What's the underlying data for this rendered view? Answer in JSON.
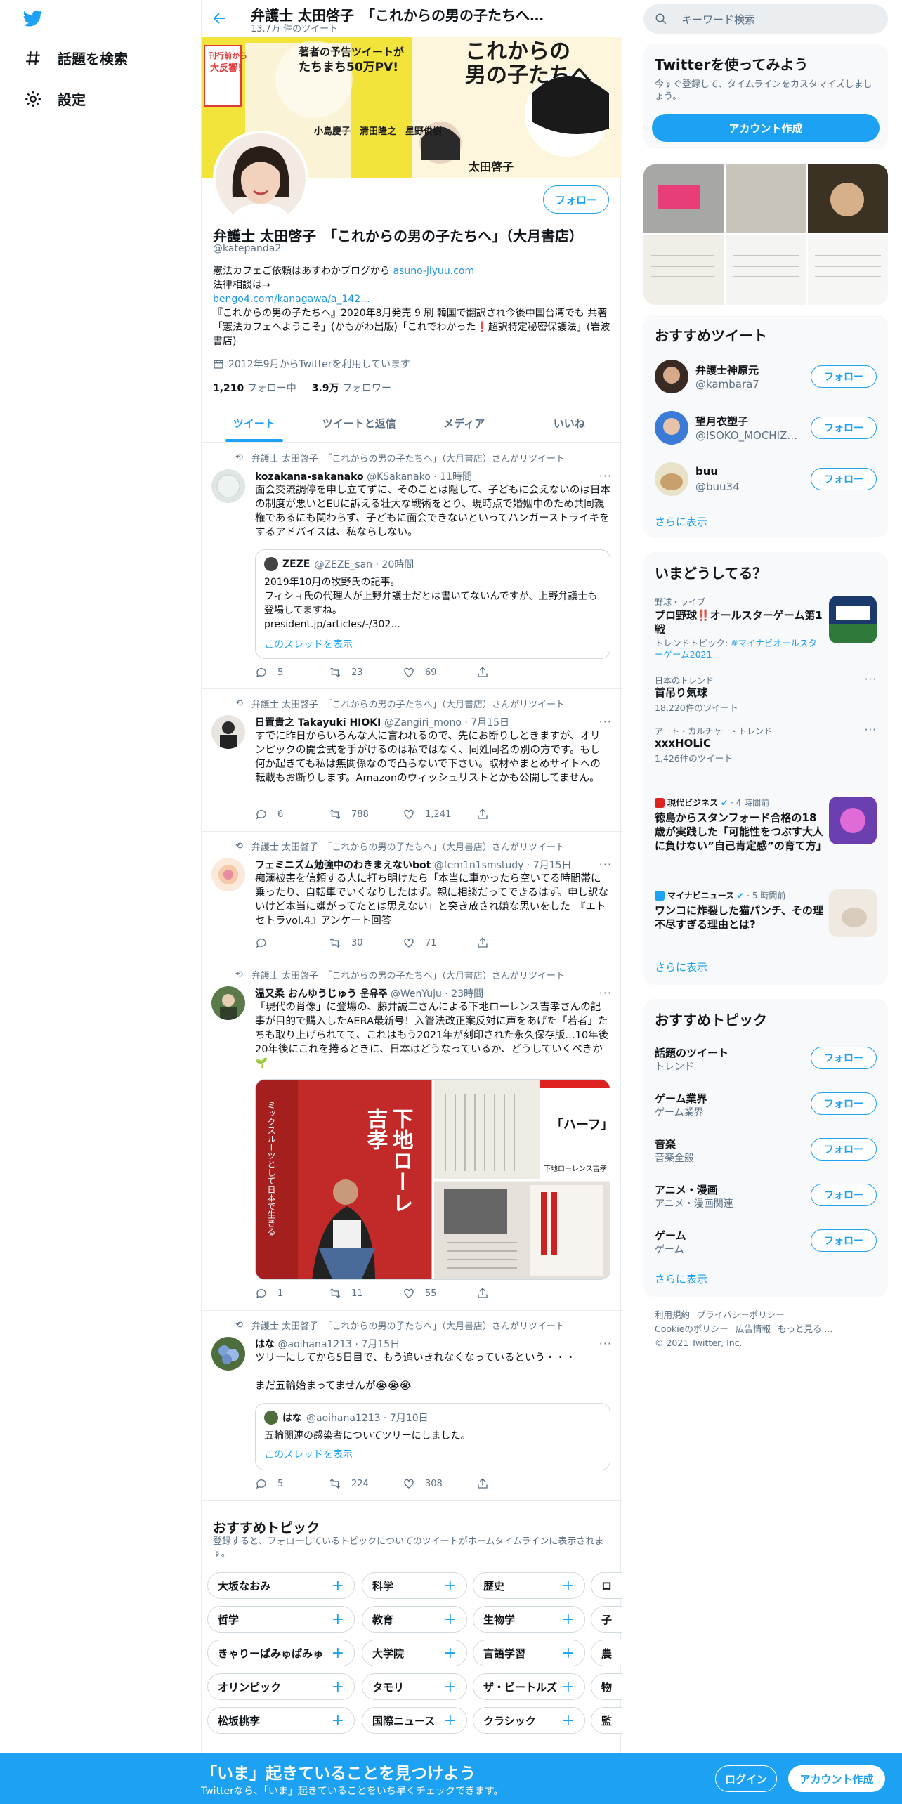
{
  "nav": {
    "explore": "話題を検索",
    "settings": "設定"
  },
  "profile": {
    "title": "弁護士 太田啓子　「これからの男の子たちへ…",
    "tweet_count": "13.7万 件のツイート",
    "name": "弁護士 太田啓子　「これからの男の子たちへ」（大月書店）",
    "handle": "@katepanda2",
    "bio1": "憲法カフェご依頼はあすわかブログから ",
    "bio1_link": "asuno-jiyuu.com",
    "bio2": "法律相談は→",
    "bio3_link": "bengo4.com/kanagawa/a_142...",
    "bio4": "『これからの男の子たちへ』2020年8月発売  9 刷 韓国で翻訳され今後中国台湾でも 共著「憲法カフェへようこそ」(かもがわ出版)「これでわかった❗️超訳特定秘密保護法」(岩波書店)",
    "joined": "2012年9月からTwitterを利用しています",
    "following_num": "1,210",
    "following_label": "フォロー中",
    "followers_num": "3.9万",
    "followers_label": "フォロワー",
    "follow_btn": "フォロー",
    "banner": {
      "t1": "これからの",
      "t2": "男の子たちへ",
      "badge1": "刊行前から",
      "badge2": "大反響！",
      "pv1": "著者の予告ツイートが",
      "pv2": "たちまち50万PV!",
      "authors": "小島慶子　清田隆之　星野俊樹",
      "author_main": "太田啓子"
    }
  },
  "tabs": [
    "ツイート",
    "ツイートと返信",
    "メディア",
    "いいね"
  ],
  "rt_label": "弁護士 太田啓子　「これからの男の子たちへ」（大月書店）さんがリツイート",
  "tweets": [
    {
      "name": "kozakana-sakanako",
      "handle": "@KSakanako",
      "time": "· 11時間",
      "text": "面会交流調停を申し立てずに、そのことは隠して、子どもに会えないのは日本の制度が悪いとEUに訴える壮大な戦術をとり、現時点で婚姻中のため共同親権であるにも関わらず、子どもに面会できないといってハンガーストライキをするアドバイスは、私ならしない。",
      "quote": {
        "name": "ZEZE",
        "handle": "@ZEZE_san · 20時間",
        "text": "2019年10月の牧野氏の記事。\nフィショ氏の代理人が上野弁護士だとは書いてないんですが、上野弁護士も登場してますね。\n president.jp/articles/-/302...",
        "thread": "このスレッドを表示"
      },
      "replies": "5",
      "retweets": "23",
      "likes": "69"
    },
    {
      "name": "日置貴之 Takayuki HIOKI",
      "handle": "@Zangiri_mono",
      "time": "· 7月15日",
      "text": "すでに昨日からいろんな人に言われるので、先にお断りしときますが、オリンピックの開会式を手がけるのは私ではなく、同姓同名の別の方です。もし何か起きても私は無関係なので凸らないで下さい。取材やまとめサイトへの転載もお断りします。Amazonのウィッシュリストとかも公開してません。",
      "replies": "6",
      "retweets": "788",
      "likes": "1,241"
    },
    {
      "name": "フェミニズム勉強中のわきまえないbot",
      "handle": "@fem1n1smstudy",
      "time": "· 7月15日",
      "text": "痴漢被害を信頼する人に打ち明けたら「本当に車かったら空いてる時間帯に乗ったり、自転車でいくなりしたはず。親に相談だってできるはず。申し訳ないけど本当に嫌がってたとは思えない」と突き放され嫌な思いをした　『エトセトラvol.4』アンケート回答",
      "replies": "",
      "retweets": "30",
      "likes": "71"
    },
    {
      "name": "温又柔 おんゆうじゅう 운유주",
      "handle": "@WenYuju",
      "time": "· 23時間",
      "text": "「現代の肖像」に登場の、藤井誠二さんによる下地ローレンス吉孝さんの記事が目的で購入したAERA最新号！入管法改正案反対に声をあげた「若者」たちも取り上げられてて、これはもう2021年が刻印された永久保存版…10年後20年後にこれを捲るときに、日本はどうなっているか、どうしていくべきか🌱",
      "img": {
        "a": "下地ローレ",
        "b": "吉孝",
        "c": "ミックスルーツとして日本で生きる",
        "d": "「ハーフ」なんだろ",
        "e": "下地ローレンス吉孝"
      },
      "replies": "1",
      "retweets": "11",
      "likes": "55"
    },
    {
      "name": "はな",
      "handle": "@aoihana1213",
      "time": "· 7月15日",
      "text": "ツリーにしてから5日目で、もう追いきれなくなっているという・・・\n\nまだ五輪始まってませんが😭😭😭",
      "quote": {
        "name": "はな",
        "handle": "@aoihana1213 · 7月10日",
        "text": "五輪関連の感染者についてツリーにしました。",
        "thread": "このスレッドを表示"
      },
      "replies": "5",
      "retweets": "224",
      "likes": "308"
    }
  ],
  "topics": {
    "title": "おすすめトピック",
    "subtitle": "登録すると、フォローしているトピックについてのツイートがホームタイムラインに表示されます。",
    "rows": [
      [
        "大坂なおみ",
        "科学",
        "歴史",
        "ロ"
      ],
      [
        "哲学",
        "教育",
        "生物学",
        "子"
      ],
      [
        "きゃりーぱみゅぱみゅ",
        "大学院",
        "言語学習",
        "農"
      ],
      [
        "オリンピック",
        "タモリ",
        "ザ・ビートルズ",
        "物"
      ],
      [
        "松坂桃李",
        "国際ニュース",
        "クラシック",
        "監"
      ]
    ]
  },
  "sidebar": {
    "search_placeholder": "キーワード検索",
    "signup_title": "Twitterを使ってみよう",
    "signup_text": "今すぐ登録して、タイムラインをカスタマイズしましょう。",
    "signup_btn": "アカウント作成",
    "wtf_title": "おすすめツイート",
    "wtf": [
      {
        "name": "弁護士神原元",
        "handle": "@kambara7",
        "btn": "フォロー"
      },
      {
        "name": "望月衣塑子",
        "handle": "@ISOKO_MOCHIZUKI",
        "btn": "フォロー"
      },
      {
        "name": "buu",
        "handle": "@buu34",
        "btn": "フォロー"
      }
    ],
    "show_more": "さらに表示",
    "trends_title": "いまどうしてる？",
    "trends": [
      {
        "cat": "野球・ライブ",
        "title": "プロ野球‼️オールスターゲーム第1戦",
        "sub1": "トレンドトピック: ",
        "sub_link": "#マイナビオールスターゲーム2021"
      },
      {
        "cat": "日本のトレンド",
        "title": "首吊り気球",
        "sub": "18,220件のツイート"
      },
      {
        "cat": "アート・カルチャー・トレンド",
        "title": "xxxHOLiC",
        "sub": "1,426件のツイート"
      },
      {
        "source": "現代ビジネス",
        "time": "· 4 時間前",
        "title": "徳島からスタンフォード合格の18歳が実践した「可能性をつぶす大人に負けない”自己肯定感”の育て方」"
      },
      {
        "source": "マイナビニュース",
        "time": "· 5 時間前",
        "title": "ワンコに炸裂した猫パンチ、その理不尽すぎる理由とは?"
      }
    ],
    "topics_title": "おすすめトピック",
    "topics": [
      {
        "name": "話題のツイート",
        "sub": "トレンド"
      },
      {
        "name": "ゲーム業界",
        "sub": "ゲーム業界"
      },
      {
        "name": "音楽",
        "sub": "音楽全般"
      },
      {
        "name": "アニメ・漫画",
        "sub": "アニメ・漫画関連"
      },
      {
        "name": "ゲーム",
        "sub": "ゲーム"
      }
    ],
    "footer": [
      "利用規約",
      "プライバシーポリシー",
      "Cookieのポリシー",
      "広告情報",
      "もっと見る ...",
      "© 2021 Twitter, Inc."
    ]
  },
  "bottom": {
    "headline": "「いま」起きていることを見つけよう",
    "sub": "Twitterなら、「いま」起きていることをいち早くチェックできます。",
    "login": "ログイン",
    "signup": "アカウント作成"
  },
  "colors": {
    "accent": "#1da1f2",
    "text": "#0f1419",
    "muted": "#5b7083",
    "border": "#e6ecf0"
  }
}
